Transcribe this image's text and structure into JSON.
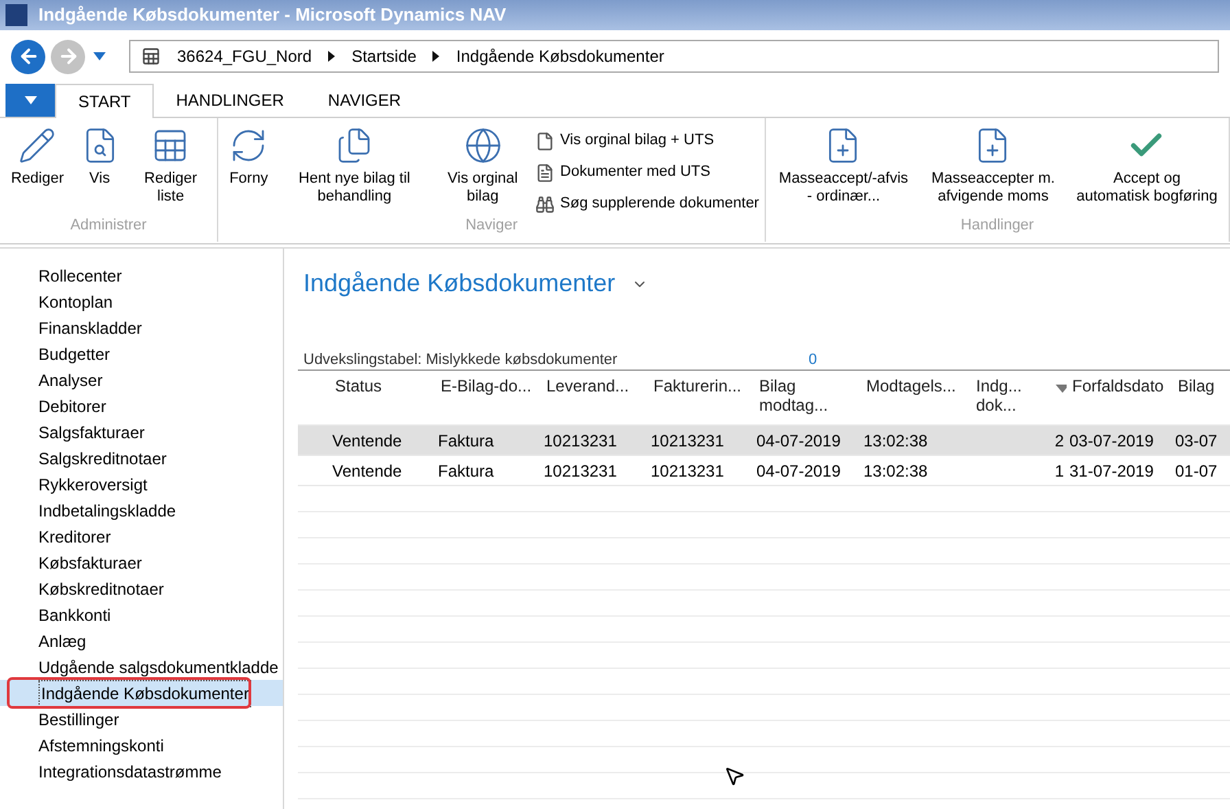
{
  "window": {
    "title": "Indgående Købsdokumenter - Microsoft Dynamics NAV"
  },
  "breadcrumb": [
    "36624_FGU_Nord",
    "Startside",
    "Indgående Købsdokumenter"
  ],
  "ribbon_tabs": [
    {
      "label": "START",
      "selected": true
    },
    {
      "label": "HANDLINGER",
      "selected": false
    },
    {
      "label": "NAVIGER",
      "selected": false
    }
  ],
  "ribbon_groups": [
    {
      "title": "Administrer",
      "items": [
        {
          "kind": "large",
          "label": "Rediger"
        },
        {
          "kind": "large",
          "label": "Vis"
        },
        {
          "kind": "large",
          "label": "Rediger liste"
        }
      ]
    },
    {
      "title": "Naviger",
      "items": [
        {
          "kind": "large",
          "label": "Forny"
        },
        {
          "kind": "large",
          "label": "Hent nye bilag til behandling"
        },
        {
          "kind": "large",
          "label": "Vis orginal bilag"
        },
        {
          "kind": "small",
          "label": "Vis orginal bilag + UTS"
        },
        {
          "kind": "small",
          "label": "Dokumenter med UTS"
        },
        {
          "kind": "small",
          "label": "Søg supplerende dokumenter"
        }
      ]
    },
    {
      "title": "Handlinger",
      "items": [
        {
          "kind": "large",
          "label": "Masseaccept/-afvis - ordinær..."
        },
        {
          "kind": "large",
          "label": "Masseaccepter m. afvigende moms"
        },
        {
          "kind": "large",
          "label": "Accept og automatisk bogføring"
        }
      ]
    }
  ],
  "sidebar": {
    "items": [
      {
        "label": "Rollecenter",
        "selected": false
      },
      {
        "label": "Kontoplan",
        "selected": false
      },
      {
        "label": "Finanskladder",
        "selected": false
      },
      {
        "label": "Budgetter",
        "selected": false
      },
      {
        "label": "Analyser",
        "selected": false
      },
      {
        "label": "Debitorer",
        "selected": false
      },
      {
        "label": "Salgsfakturaer",
        "selected": false
      },
      {
        "label": "Salgskreditnotaer",
        "selected": false
      },
      {
        "label": "Rykkeroversigt",
        "selected": false
      },
      {
        "label": "Indbetalingskladde",
        "selected": false
      },
      {
        "label": "Kreditorer",
        "selected": false
      },
      {
        "label": "Købsfakturaer",
        "selected": false
      },
      {
        "label": "Købskreditnotaer",
        "selected": false
      },
      {
        "label": "Bankkonti",
        "selected": false
      },
      {
        "label": "Anlæg",
        "selected": false
      },
      {
        "label": "Udgående salgsdokumentkladde",
        "selected": false
      },
      {
        "label": "Indgående Købsdokumenter",
        "selected": true
      },
      {
        "label": "Bestillinger",
        "selected": false
      },
      {
        "label": "Afstemningskonti",
        "selected": false
      },
      {
        "label": "Integrationsdatastrømme",
        "selected": false
      }
    ]
  },
  "page": {
    "title": "Indgående Købsdokumenter",
    "cue": {
      "label": "Udvekslingstabel: Mislykkede købsdokumenter",
      "value": "0"
    }
  },
  "table": {
    "columns": [
      {
        "label": "Status",
        "sorted": false
      },
      {
        "label": "E-Bilag-do...",
        "sorted": false
      },
      {
        "label": "Leverand...",
        "sorted": false
      },
      {
        "label": "Fakturerin...",
        "sorted": false
      },
      {
        "label": "Bilag modtag...",
        "sorted": false
      },
      {
        "label": "Modtagels...",
        "sorted": false
      },
      {
        "label": "Indg... dok...",
        "sorted": true
      },
      {
        "label": "Forfaldsdato",
        "sorted": false
      },
      {
        "label": "Bilag",
        "sorted": false
      }
    ],
    "rows": [
      {
        "selected": true,
        "cells": [
          "Ventende",
          "Faktura",
          "10213231",
          "10213231",
          "04-07-2019",
          "13:02:38",
          "2",
          "03-07-2019",
          "03-07"
        ]
      },
      {
        "selected": false,
        "cells": [
          "Ventende",
          "Faktura",
          "10213231",
          "10213231",
          "04-07-2019",
          "13:02:38",
          "1",
          "31-07-2019",
          "01-07"
        ]
      }
    ]
  }
}
